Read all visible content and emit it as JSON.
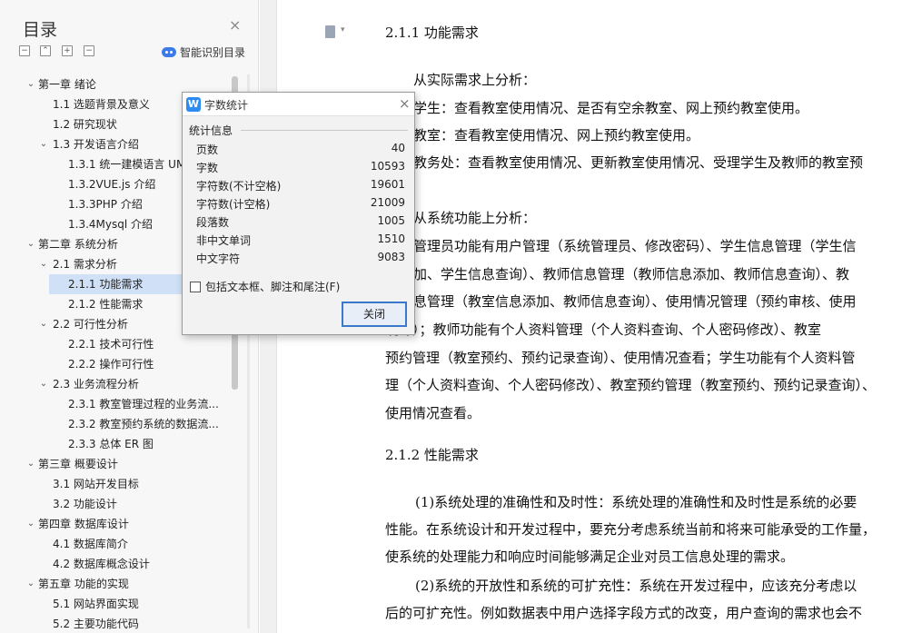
{
  "toc": {
    "title": "目录",
    "close_glyph": "×",
    "toolbar": [
      {
        "name": "collapse-all-button",
        "glyph": "−"
      },
      {
        "name": "expand-level-button",
        "glyph": "⌃"
      },
      {
        "name": "add-heading-button",
        "glyph": "+"
      },
      {
        "name": "remove-heading-button",
        "glyph": "−"
      }
    ],
    "smart_label": "智能识别目录",
    "items": [
      {
        "level": 1,
        "expanded": true,
        "label": "第一章  绪论"
      },
      {
        "level": 2,
        "expanded": null,
        "label": "1.1  选题背景及意义"
      },
      {
        "level": 2,
        "expanded": null,
        "label": "1.2  研究现状"
      },
      {
        "level": 2,
        "expanded": true,
        "label": "1.3  开发语言介绍"
      },
      {
        "level": 3,
        "expanded": null,
        "label": "1.3.1  统一建模语言 UML"
      },
      {
        "level": 3,
        "expanded": null,
        "label": "1.3.2VUE.js 介绍"
      },
      {
        "level": 3,
        "expanded": null,
        "label": "1.3.3PHP 介绍"
      },
      {
        "level": 3,
        "expanded": null,
        "label": "1.3.4Mysql 介绍"
      },
      {
        "level": 1,
        "expanded": true,
        "label": "第二章  系统分析"
      },
      {
        "level": 2,
        "expanded": true,
        "label": "2.1  需求分析"
      },
      {
        "level": 3,
        "expanded": null,
        "label": "2.1.1 功能需求",
        "selected": true
      },
      {
        "level": 3,
        "expanded": null,
        "label": "2.1.2 性能需求"
      },
      {
        "level": 2,
        "expanded": true,
        "label": "2.2  可行性分析"
      },
      {
        "level": 3,
        "expanded": null,
        "label": "2.2.1  技术可行性"
      },
      {
        "level": 3,
        "expanded": null,
        "label": "2.2.2  操作可行性"
      },
      {
        "level": 2,
        "expanded": true,
        "label": "2.3  业务流程分析"
      },
      {
        "level": 3,
        "expanded": null,
        "label": "2.3.1  教室管理过程的业务流..."
      },
      {
        "level": 3,
        "expanded": null,
        "label": "2.3.2  教室预约系统的数据流..."
      },
      {
        "level": 3,
        "expanded": null,
        "label": "2.3.3  总体 ER 图"
      },
      {
        "level": 1,
        "expanded": true,
        "label": "第三章  概要设计"
      },
      {
        "level": 2,
        "expanded": null,
        "label": "3.1  网站开发目标"
      },
      {
        "level": 2,
        "expanded": null,
        "label": "3.2  功能设计"
      },
      {
        "level": 1,
        "expanded": true,
        "label": "第四章  数据库设计"
      },
      {
        "level": 2,
        "expanded": null,
        "label": "4.1  数据库简介"
      },
      {
        "level": 2,
        "expanded": null,
        "label": "4.2  数据库概念设计"
      },
      {
        "level": 1,
        "expanded": true,
        "label": "第五章  功能的实现"
      },
      {
        "level": 2,
        "expanded": null,
        "label": "5.1  网站界面实现"
      },
      {
        "level": 2,
        "expanded": null,
        "label": "5.2  主要功能代码"
      }
    ]
  },
  "document": {
    "lines": [
      {
        "text": "2.1.1 功能需求",
        "heading": true
      },
      {
        "text": "从实际需求上分析："
      },
      {
        "text": "学生：查看教室使用情况、是否有空余教室、网上预约教室使用。"
      },
      {
        "text": "教室：查看教室使用情况、网上预约教室使用。"
      },
      {
        "text": "教务处：查看教室使用情况、更新教室使用情况、受理学生及教师的教室预"
      },
      {
        "text": "从系统功能上分析："
      },
      {
        "text": "管理员功能有用户管理（系统管理员、修改密码）、学生信息管理（学生信"
      },
      {
        "text": "加、学生信息查询）、教师信息管理（教师信息添加、教师信息查询）、教"
      },
      {
        "text": "息管理（教室信息添加、教师信息查询）、使用情况管理（预约审核、使用"
      },
      {
        "text": "统计）；教师功能有个人资料管理（个人资料查询、个人密码修改）、教室"
      },
      {
        "text": "预约管理（教室预约、预约记录查询）、使用情况查看；学生功能有个人资料管"
      },
      {
        "text": "理（个人资料查询、个人密码修改）、教室预约管理（教室预约、预约记录查询）、"
      },
      {
        "text": "使用情况查看。"
      },
      {
        "text": "2.1.2 性能需求",
        "heading": true
      },
      {
        "text": "(1)系统处理的准确性和及时性：系统处理的准确性和及时性是系统的必要"
      },
      {
        "text": "性能。在系统设计和开发过程中，要充分考虑系统当前和将来可能承受的工作量，"
      },
      {
        "text": "使系统的处理能力和响应时间能够满足企业对员工信息处理的需求。"
      },
      {
        "text": "(2)系统的开放性和系统的可扩充性：系统在开发过程中，应该充分考虑以"
      },
      {
        "text": "后的可扩充性。例如数据表中用户选择字段方式的改变，用户查询的需求也会不"
      }
    ]
  },
  "dialog": {
    "app_icon": "W",
    "title": "字数统计",
    "close_glyph": "×",
    "section": "统计信息",
    "stats": [
      {
        "label": "页数",
        "value": "40"
      },
      {
        "label": "字数",
        "value": "10593"
      },
      {
        "label": "字符数(不计空格)",
        "value": "19601"
      },
      {
        "label": "字符数(计空格)",
        "value": "21009"
      },
      {
        "label": "段落数",
        "value": "1005"
      },
      {
        "label": "非中文单词",
        "value": "1510"
      },
      {
        "label": "中文字符",
        "value": "9083"
      }
    ],
    "checkbox_label": "包括文本框、脚注和尾注(F)",
    "checkbox_checked": false,
    "close_button": "关闭"
  }
}
